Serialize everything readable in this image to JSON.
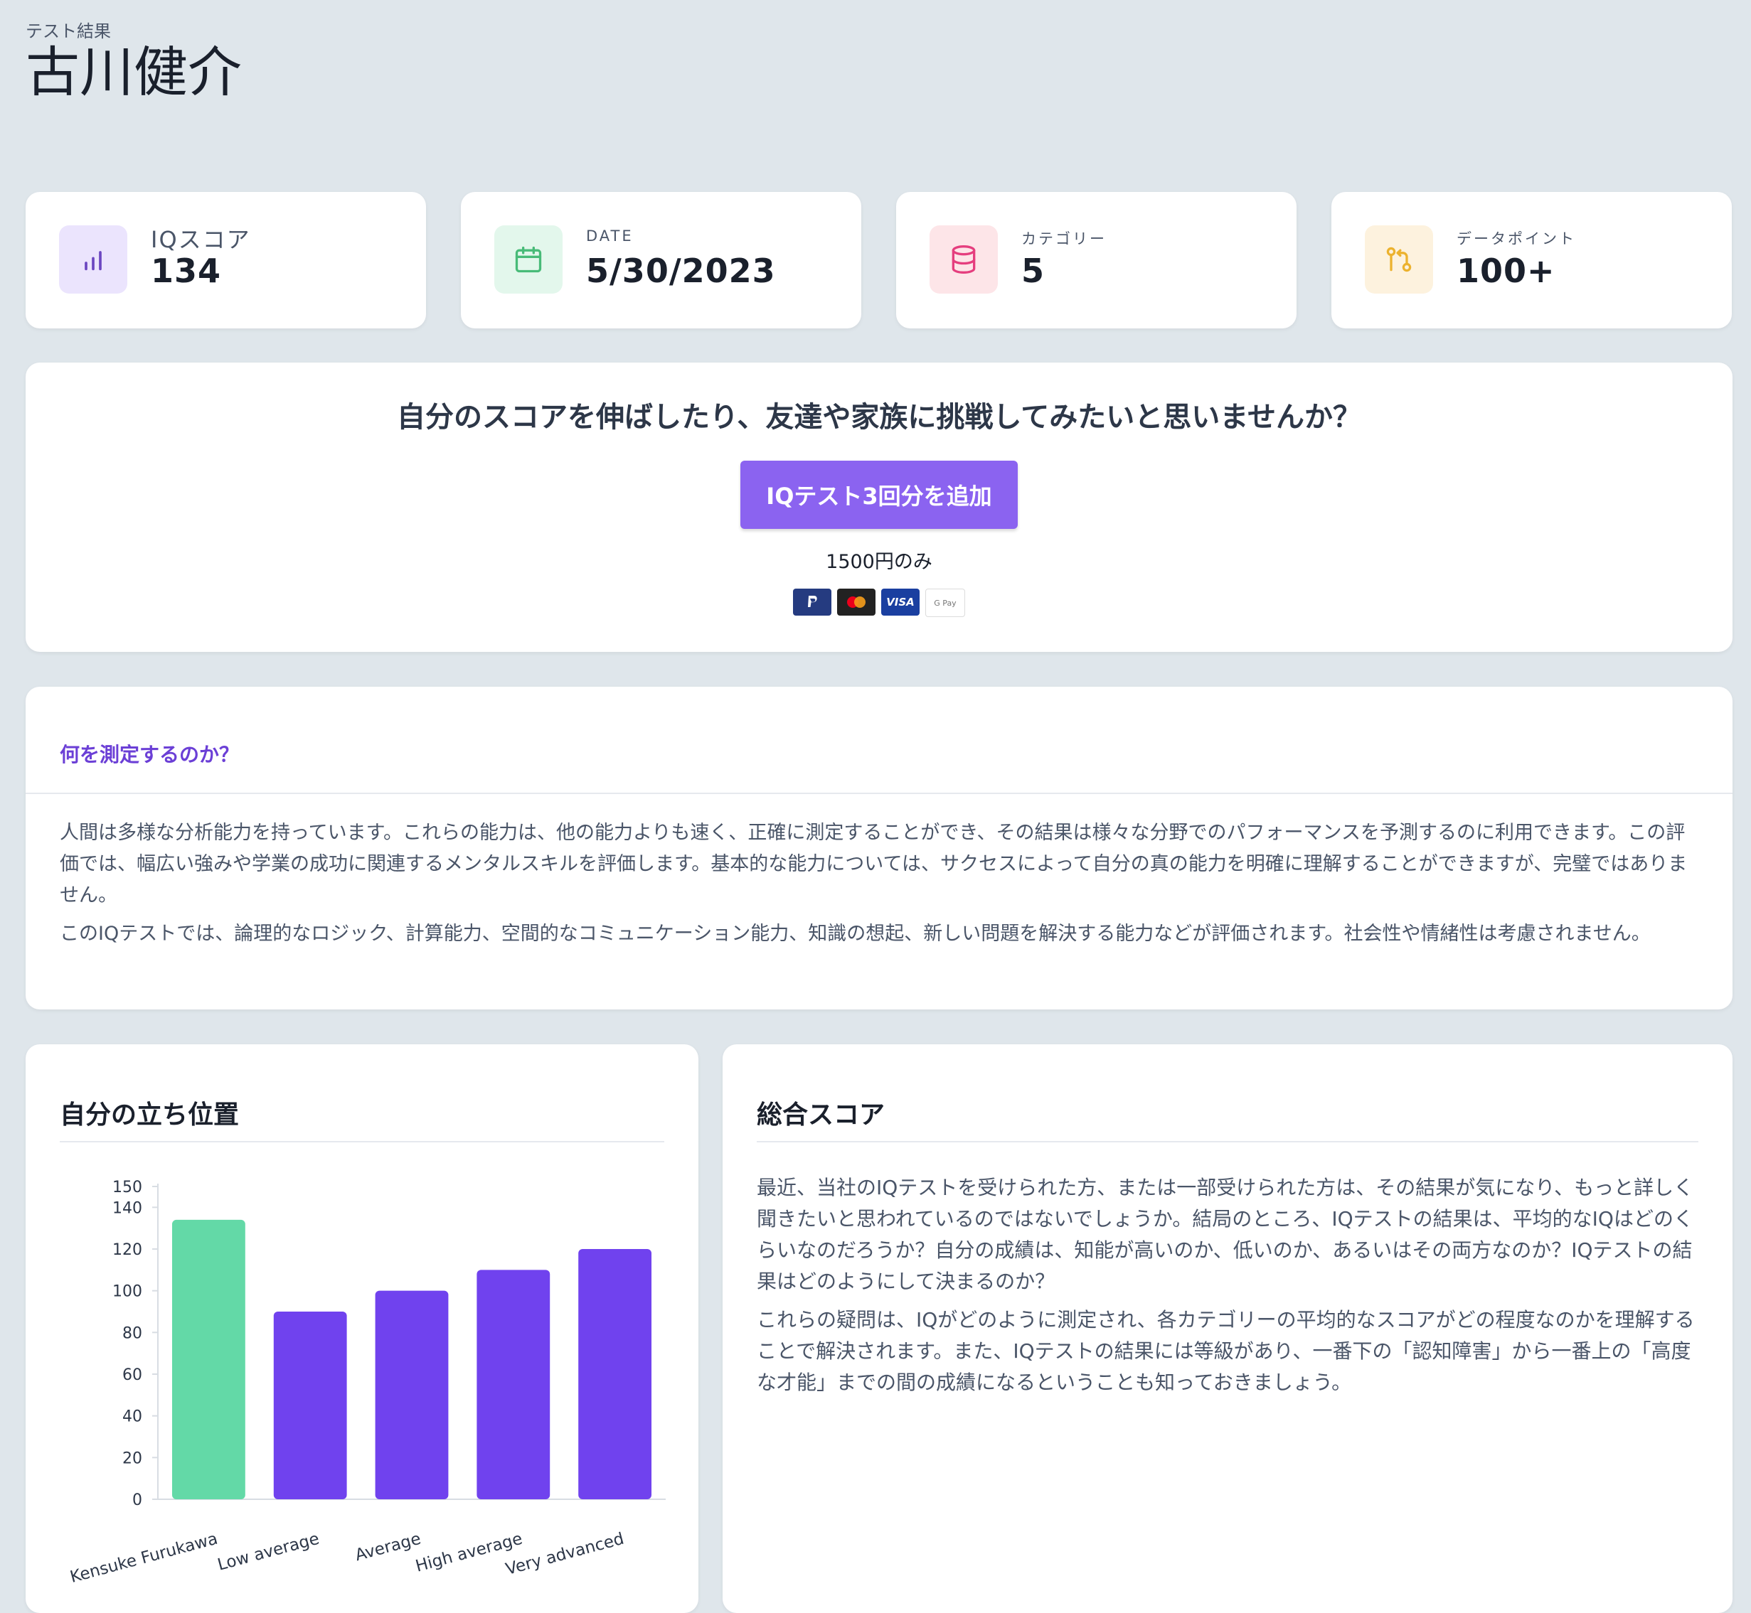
{
  "header": {
    "subtitle": "テスト結果",
    "name": "古川健介"
  },
  "stats": [
    {
      "label": "IQスコア",
      "value": "134",
      "icon": "bar-chart-icon",
      "color": "#6b46c1",
      "bg": "#ebe4fd"
    },
    {
      "label": "DATE",
      "value": "5/30/2023",
      "icon": "calendar-icon",
      "color": "#48bb78",
      "bg": "#e3f7ec"
    },
    {
      "label": "カテゴリー",
      "value": "5",
      "icon": "database-icon",
      "color": "#e53e7e",
      "bg": "#fde5e8"
    },
    {
      "label": "データポイント",
      "value": "100+",
      "icon": "git-pull-request-icon",
      "color": "#ecb22e",
      "bg": "#fdf2de"
    }
  ],
  "cta": {
    "title": "自分のスコアを伸ばしたり、友達や家族に挑戦してみたいと思いませんか？",
    "button_label": "IQテスト3回分を追加",
    "price": "1500円のみ",
    "payment_methods": [
      "PayPal",
      "Mastercard",
      "VISA",
      "G Pay"
    ]
  },
  "measure": {
    "title": "何を測定するのか？",
    "paragraphs": [
      "人間は多様な分析能力を持っています。これらの能力は、他の能力よりも速く、正確に測定することができ、その結果は様々な分野でのパフォーマンスを予測するのに利用できます。この評価では、幅広い強みや学業の成功に関連するメンタルスキルを評価します。基本的な能力については、サクセスによって自分の真の能力を明確に理解することができますが、完璧ではありません。",
      "このIQテストでは、論理的なロジック、計算能力、空間的なコミュニケーション能力、知識の想起、新しい問題を解決する能力などが評価されます。社会性や情緒性は考慮されません。"
    ]
  },
  "position": {
    "title": "自分の立ち位置"
  },
  "total": {
    "title": "総合スコア",
    "paragraphs": [
      "最近、当社のIQテストを受けられた方、または一部受けられた方は、その結果が気になり、もっと詳しく聞きたいと思われているのではないでしょうか。結局のところ、IQテストの結果は、平均的なIQはどのくらいなのだろうか？自分の成績は、知能が高いのか、低いのか、あるいはその両方なのか？IQテストの結果はどのようにして決まるのか？",
      "これらの疑問は、IQがどのように測定され、各カテゴリーの平均的なスコアがどの程度なのかを理解することで解決されます。また、IQテストの結果には等級があり、一番下の「認知障害」から一番上の「高度な才能」までの間の成績になるということも知っておきましょう。"
    ]
  },
  "chart_data": {
    "type": "bar",
    "categories": [
      "Kensuke Furukawa",
      "Low average",
      "Average",
      "High average",
      "Very advanced"
    ],
    "values": [
      134,
      90,
      100,
      110,
      120
    ],
    "colors": [
      "#63d9a7",
      "#7042ee",
      "#7042ee",
      "#7042ee",
      "#7042ee"
    ],
    "yticks": [
      0,
      20,
      40,
      60,
      80,
      100,
      120,
      140,
      150
    ],
    "ylim": [
      0,
      150
    ],
    "grid": false
  }
}
